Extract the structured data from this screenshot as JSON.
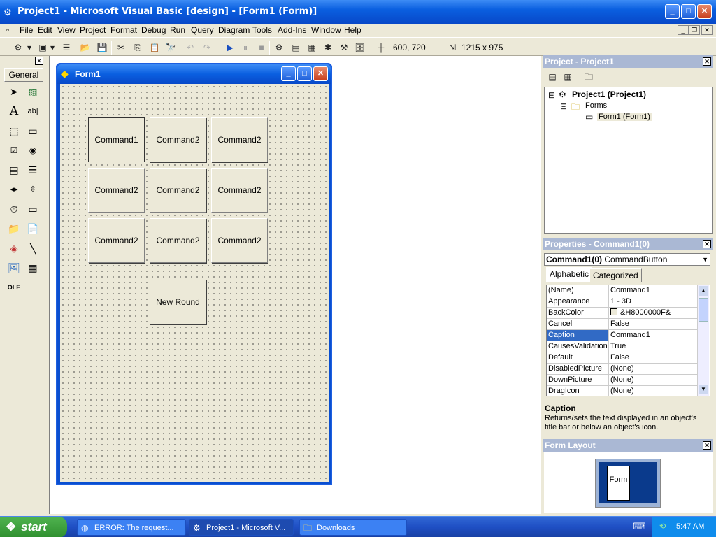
{
  "window": {
    "title": "Project1 - Microsoft Visual Basic [design] - [Form1 (Form)]",
    "min": "_",
    "max": "□",
    "close": "✕"
  },
  "menu": [
    "File",
    "Edit",
    "View",
    "Project",
    "Format",
    "Debug",
    "Run",
    "Query",
    "Diagram",
    "Tools",
    "Add-Ins",
    "Window",
    "Help"
  ],
  "toolbar": {
    "position": "600, 720",
    "size": "1215 x 975"
  },
  "toolbox": {
    "general": "General",
    "close": "✕"
  },
  "form": {
    "title": "Form1",
    "buttons": [
      "Command1",
      "Command2",
      "Command2",
      "Command2",
      "Command2",
      "Command2",
      "Command2",
      "Command2",
      "Command2"
    ],
    "new_round": "New Round"
  },
  "project": {
    "header": "Project - Project1",
    "root": "Project1 (Project1)",
    "folder": "Forms",
    "item": "Form1 (Form1)"
  },
  "properties": {
    "header": "Properties - Command1(0)",
    "object_name": "Command1(0)",
    "object_type": "CommandButton",
    "tab_alpha": "Alphabetic",
    "tab_cat": "Categorized",
    "rows": [
      {
        "name": "(Name)",
        "value": "Command1"
      },
      {
        "name": "Appearance",
        "value": "1 - 3D"
      },
      {
        "name": "BackColor",
        "value": "&H8000000F&"
      },
      {
        "name": "Cancel",
        "value": "False"
      },
      {
        "name": "Caption",
        "value": "Command1"
      },
      {
        "name": "CausesValidation",
        "value": "True"
      },
      {
        "name": "Default",
        "value": "False"
      },
      {
        "name": "DisabledPicture",
        "value": "(None)"
      },
      {
        "name": "DownPicture",
        "value": "(None)"
      },
      {
        "name": "DragIcon",
        "value": "(None)"
      }
    ],
    "selected_row": "Caption",
    "desc_title": "Caption",
    "desc_text": "Returns/sets the text displayed in an object's title bar or below an object's icon."
  },
  "formlayout": {
    "header": "Form Layout",
    "form_label": "Form"
  },
  "taskbar": {
    "start": "start",
    "tasks": [
      {
        "label": "ERROR: The request...",
        "icon": "browser-icon"
      },
      {
        "label": "Project1 - Microsoft V...",
        "icon": "vb-icon"
      },
      {
        "label": "Downloads",
        "icon": "folder-icon"
      }
    ],
    "clock": "5:47 AM"
  },
  "colors": {
    "titlebar": "#0a5fe0",
    "selection": "#316ac5",
    "panel_header": "#aab8d4"
  }
}
